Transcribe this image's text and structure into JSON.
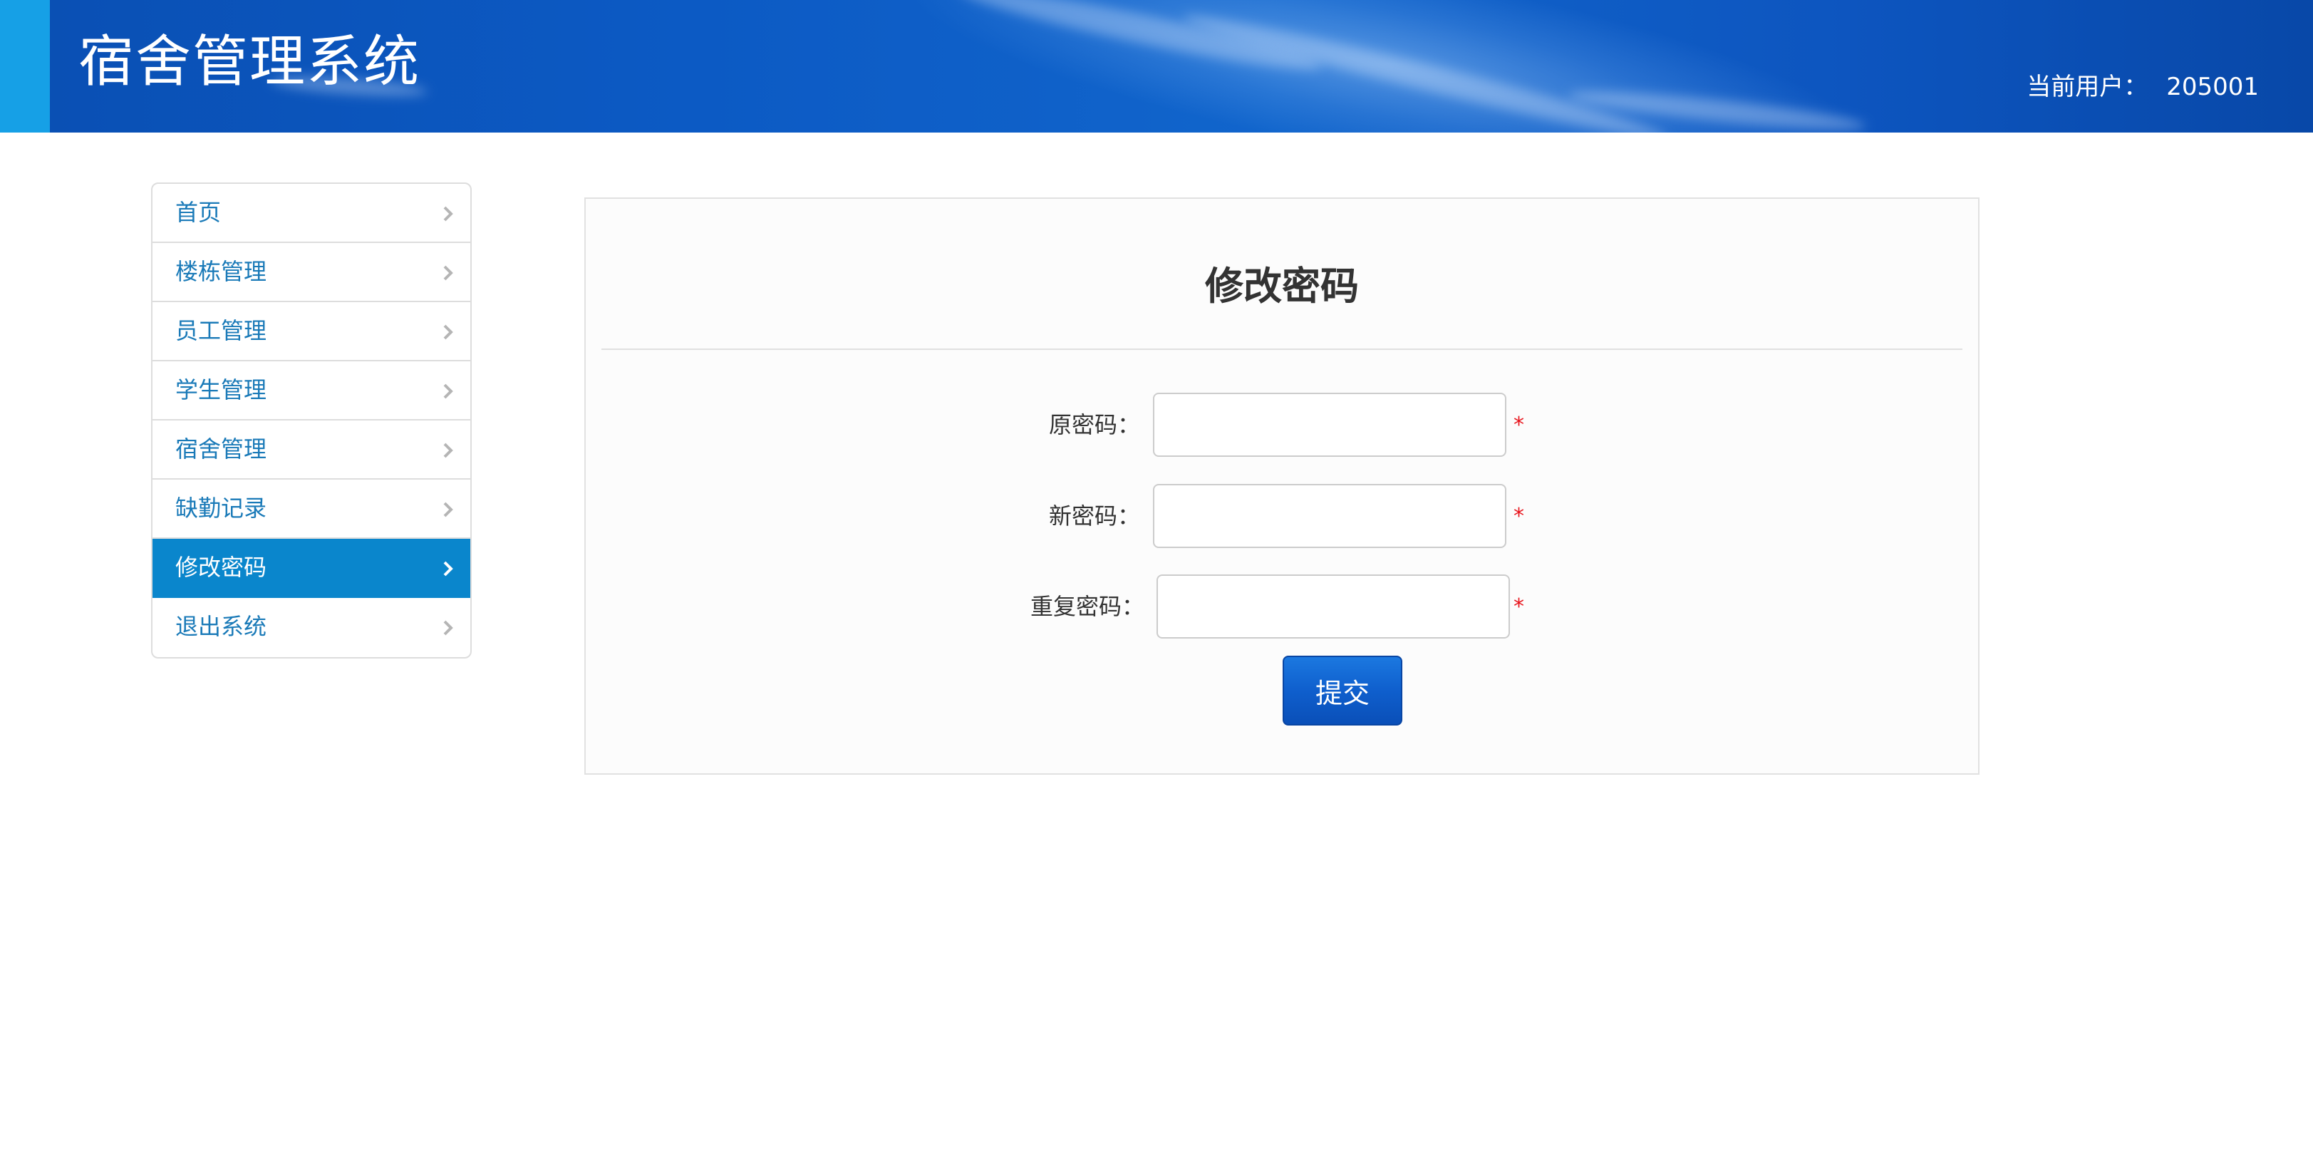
{
  "header": {
    "title": "宿舍管理系统",
    "user_label": "当前用户：",
    "user_name": "205001"
  },
  "sidebar": {
    "items": [
      {
        "label": "首页",
        "active": false
      },
      {
        "label": "楼栋管理",
        "active": false
      },
      {
        "label": "员工管理",
        "active": false
      },
      {
        "label": "学生管理",
        "active": false
      },
      {
        "label": "宿舍管理",
        "active": false
      },
      {
        "label": "缺勤记录",
        "active": false
      },
      {
        "label": "修改密码",
        "active": true
      },
      {
        "label": "退出系统",
        "active": false
      }
    ]
  },
  "form": {
    "title": "修改密码",
    "fields": [
      {
        "label": "原密码：",
        "value": "",
        "required_mark": "*"
      },
      {
        "label": "新密码：",
        "value": "",
        "required_mark": "*"
      },
      {
        "label": "重复密码：",
        "value": "",
        "required_mark": "*"
      }
    ],
    "submit_label": "提交"
  },
  "colors": {
    "header_blue": "#0c5ac4",
    "accent": "#16a0e6",
    "nav_active": "#0a86cc",
    "nav_text": "#1a7ab8",
    "required": "#e8141c",
    "button": "#0f5fcd"
  },
  "icons": {
    "nav_chevron": "chevron-right-icon"
  }
}
